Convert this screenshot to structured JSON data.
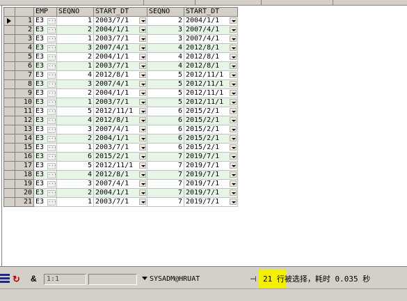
{
  "columns": [
    "EMP",
    "SEQNO",
    "START_DT",
    "SEQNO",
    "START_DT"
  ],
  "rows": [
    {
      "n": "1",
      "emp": "E3",
      "seq1": "1",
      "dt1": "2003/7/1",
      "seq2": "2",
      "dt2": "2004/1/1"
    },
    {
      "n": "2",
      "emp": "E3",
      "seq1": "2",
      "dt1": "2004/1/1",
      "seq2": "3",
      "dt2": "2007/4/1"
    },
    {
      "n": "3",
      "emp": "E3",
      "seq1": "1",
      "dt1": "2003/7/1",
      "seq2": "3",
      "dt2": "2007/4/1"
    },
    {
      "n": "4",
      "emp": "E3",
      "seq1": "3",
      "dt1": "2007/4/1",
      "seq2": "4",
      "dt2": "2012/8/1"
    },
    {
      "n": "5",
      "emp": "E3",
      "seq1": "2",
      "dt1": "2004/1/1",
      "seq2": "4",
      "dt2": "2012/8/1"
    },
    {
      "n": "6",
      "emp": "E3",
      "seq1": "1",
      "dt1": "2003/7/1",
      "seq2": "4",
      "dt2": "2012/8/1"
    },
    {
      "n": "7",
      "emp": "E3",
      "seq1": "4",
      "dt1": "2012/8/1",
      "seq2": "5",
      "dt2": "2012/11/1"
    },
    {
      "n": "8",
      "emp": "E3",
      "seq1": "3",
      "dt1": "2007/4/1",
      "seq2": "5",
      "dt2": "2012/11/1"
    },
    {
      "n": "9",
      "emp": "E3",
      "seq1": "2",
      "dt1": "2004/1/1",
      "seq2": "5",
      "dt2": "2012/11/1"
    },
    {
      "n": "10",
      "emp": "E3",
      "seq1": "1",
      "dt1": "2003/7/1",
      "seq2": "5",
      "dt2": "2012/11/1"
    },
    {
      "n": "11",
      "emp": "E3",
      "seq1": "5",
      "dt1": "2012/11/1",
      "seq2": "6",
      "dt2": "2015/2/1"
    },
    {
      "n": "12",
      "emp": "E3",
      "seq1": "4",
      "dt1": "2012/8/1",
      "seq2": "6",
      "dt2": "2015/2/1"
    },
    {
      "n": "13",
      "emp": "E3",
      "seq1": "3",
      "dt1": "2007/4/1",
      "seq2": "6",
      "dt2": "2015/2/1"
    },
    {
      "n": "14",
      "emp": "E3",
      "seq1": "2",
      "dt1": "2004/1/1",
      "seq2": "6",
      "dt2": "2015/2/1"
    },
    {
      "n": "15",
      "emp": "E3",
      "seq1": "1",
      "dt1": "2003/7/1",
      "seq2": "6",
      "dt2": "2015/2/1"
    },
    {
      "n": "16",
      "emp": "E3",
      "seq1": "6",
      "dt1": "2015/2/1",
      "seq2": "7",
      "dt2": "2019/7/1"
    },
    {
      "n": "17",
      "emp": "E3",
      "seq1": "5",
      "dt1": "2012/11/1",
      "seq2": "7",
      "dt2": "2019/7/1"
    },
    {
      "n": "18",
      "emp": "E3",
      "seq1": "4",
      "dt1": "2012/8/1",
      "seq2": "7",
      "dt2": "2019/7/1"
    },
    {
      "n": "19",
      "emp": "E3",
      "seq1": "3",
      "dt1": "2007/4/1",
      "seq2": "7",
      "dt2": "2019/7/1"
    },
    {
      "n": "20",
      "emp": "E3",
      "seq1": "2",
      "dt1": "2004/1/1",
      "seq2": "7",
      "dt2": "2019/7/1"
    },
    {
      "n": "21",
      "emp": "E3",
      "seq1": "1",
      "dt1": "2003/7/1",
      "seq2": "7",
      "dt2": "2019/7/1"
    }
  ],
  "ellipsis": "···",
  "statusbar": {
    "amp": "&",
    "position": "1:1",
    "connection": "SYSADM@HRUAT",
    "row_count": "21",
    "message": "行被选择，耗时 0.035 秒",
    "pin_glyph": "⊣"
  },
  "colors": {
    "row_alt": "#e6f5e6",
    "highlight": "#f4f000",
    "chrome": "#d4d0c8"
  }
}
